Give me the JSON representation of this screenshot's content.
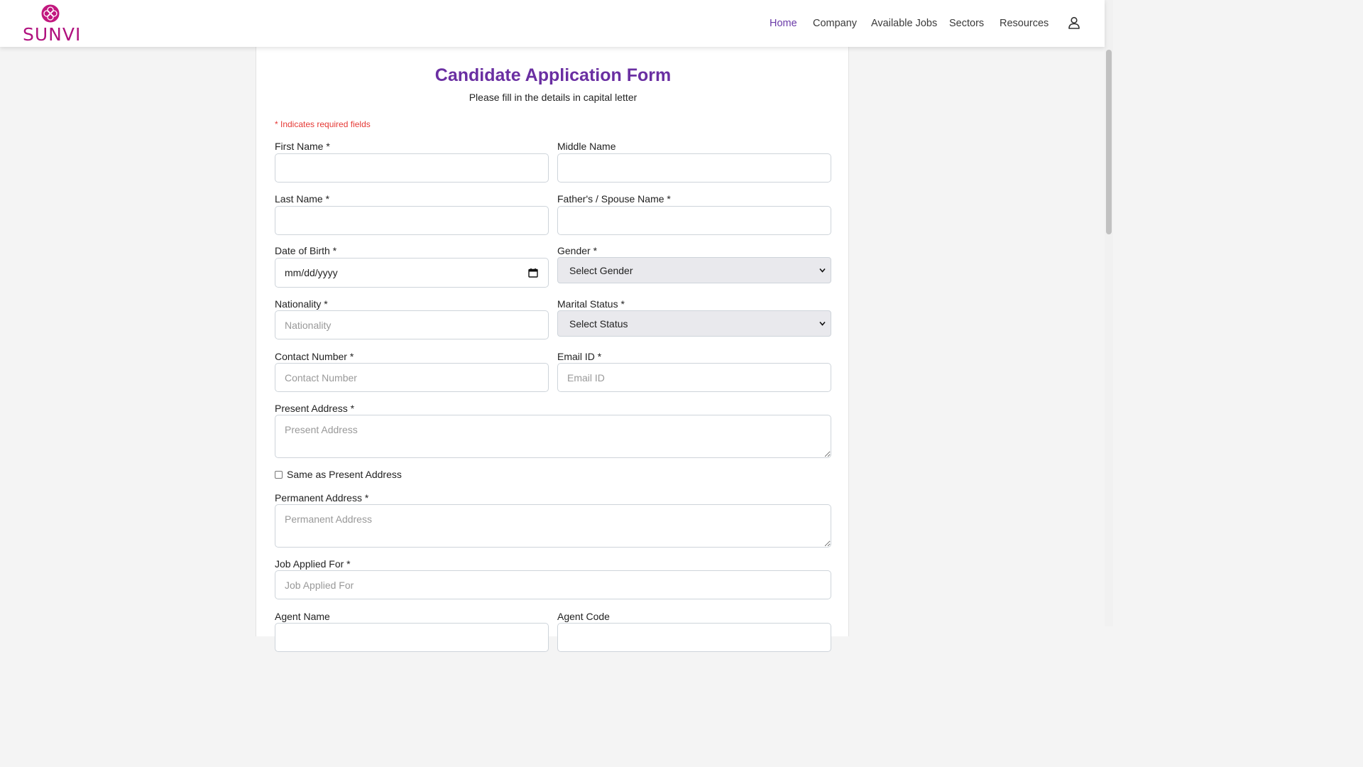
{
  "header": {
    "logo_text": "SUNVI",
    "nav": [
      "Home",
      "Company",
      "Available Jobs",
      "Sectors",
      "Resources"
    ]
  },
  "form": {
    "title": "Candidate Application Form",
    "subtitle": "Please fill in the details in capital letter",
    "required_note": "* Indicates required fields",
    "first_name": {
      "label": "First Name *",
      "value": ""
    },
    "middle_name": {
      "label": "Middle Name",
      "value": ""
    },
    "last_name": {
      "label": "Last Name *",
      "value": ""
    },
    "father_spouse_name": {
      "label": "Father's / Spouse Name *",
      "value": ""
    },
    "dob": {
      "label": "Date of Birth *",
      "value": "mm/dd/yyyy"
    },
    "gender": {
      "label": "Gender *",
      "selected": "Select Gender"
    },
    "nationality": {
      "label": "Nationality *",
      "placeholder": "Nationality"
    },
    "marital_status": {
      "label": "Marital Status *",
      "selected": "Select Status"
    },
    "contact": {
      "label": "Contact Number *",
      "placeholder": "Contact Number"
    },
    "email": {
      "label": "Email ID *",
      "placeholder": "Email ID"
    },
    "present_address": {
      "label": "Present Address *",
      "placeholder": "Present Address"
    },
    "same_as_present": {
      "label": "Same as Present Address",
      "checked": false
    },
    "permanent_address": {
      "label": "Permanent Address *",
      "placeholder": "Permanent Address"
    },
    "job_applied": {
      "label": "Job Applied For *",
      "placeholder": "Job Applied For"
    },
    "agent_name": {
      "label": "Agent Name"
    },
    "agent_code": {
      "label": "Agent Code"
    }
  },
  "colors": {
    "brand": "#6a2fa2",
    "logo": "#b0117e",
    "required": "#e53935"
  }
}
